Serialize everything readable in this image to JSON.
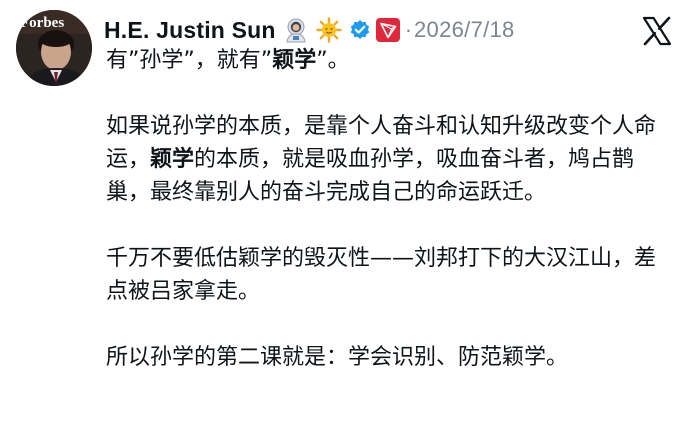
{
  "tweet": {
    "author": {
      "display_name": "H.E. Justin Sun",
      "avatar_text": "Forbes"
    },
    "badges": [
      "astronaut-emoji",
      "sun-emoji",
      "verified-badge",
      "tron-badge"
    ],
    "separator": "·",
    "date": "2026/7/18",
    "platform_icon": "x-logo-icon",
    "colors": {
      "verified": "#1d9bf0",
      "tron": "#e0283a",
      "text": "#0f1419",
      "muted": "#7a8690"
    },
    "content": {
      "line1": {
        "a": "有”孙学”，就有”",
        "b": "颖学",
        "c": "”。"
      },
      "para2": {
        "a": "如果说孙学的本质，是靠个人奋斗和认知升级改变个人命运，",
        "b": "颖学",
        "c": "的本质，就是吸血孙学，吸血奋斗者，鸠占鹊巢，最终靠别人的奋斗完成自己的命运跃迁。"
      },
      "para3": "千万不要低估颖学的毁灭性——刘邦打下的大汉江山，差点被吕家拿走。",
      "para4": "所以孙学的第二课就是：学会识别、防范颖学。"
    }
  }
}
